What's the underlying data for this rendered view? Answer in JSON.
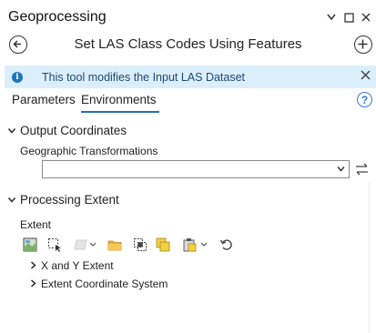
{
  "pane": {
    "title": "Geoprocessing"
  },
  "tool": {
    "title": "Set LAS Class Codes Using Features"
  },
  "info": {
    "message": "This tool modifies the Input LAS Dataset"
  },
  "tabs": [
    {
      "label": "Parameters",
      "active": false
    },
    {
      "label": "Environments",
      "active": true
    }
  ],
  "output_coordinates": {
    "title": "Output Coordinates",
    "geo_transformations_label": "Geographic Transformations",
    "geo_transformations_value": ""
  },
  "processing_extent": {
    "title": "Processing Extent",
    "extent_label": "Extent",
    "tree": [
      {
        "label": "X and Y Extent"
      },
      {
        "label": "Extent Coordinate System"
      }
    ]
  },
  "colors": {
    "info_bg": "#dbeefb",
    "accent": "#2b6cb0",
    "info_icon": "#1c75bc"
  }
}
